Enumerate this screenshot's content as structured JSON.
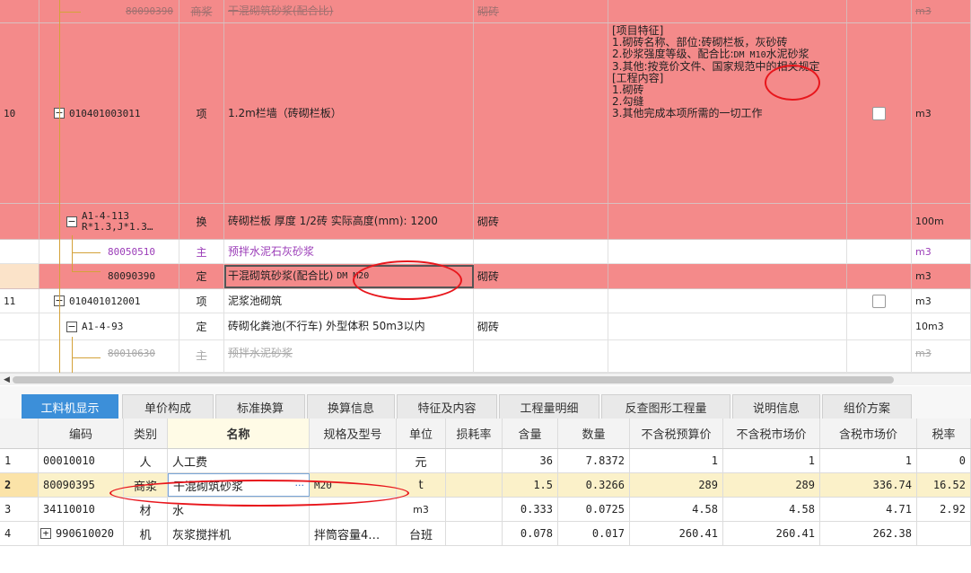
{
  "upper_rows": {
    "top_partial": {
      "code": "80090390",
      "type": "商浆",
      "name": "干混砌筑砂浆(配合比)",
      "spec": "砌砖",
      "unit": "m3"
    },
    "item10": {
      "index": "10",
      "code": "010401003011",
      "type": "项",
      "name": "1.2m栏墙（砖砌栏板）",
      "features": [
        "[项目特征]",
        "1.砌砖名称、部位:砖砌栏板，灰砂砖",
        "2.砂浆强度等级、配合比:",
        "DM M10",
        "水泥砂浆",
        "3.其他:按竞价文件、国家规范中的相关规定",
        "[工程内容]",
        "1.砌砖",
        "2.勾缝",
        "3.其他完成本项所需的一切工作"
      ],
      "unit": "m3"
    },
    "sub_a14113": {
      "code_line1": "A1-4-113",
      "code_line2": "R*1.3,J*1.3…",
      "type": "换",
      "name": "砖砌栏板 厚度 1/2砖  实际高度(mm): 1200",
      "spec": "砌砖",
      "unit": "100m"
    },
    "sub_80050510": {
      "code": "80050510",
      "type": "主",
      "name": "预拌水泥石灰砂浆",
      "unit": "m3"
    },
    "sub_80090390": {
      "code": "80090390",
      "type": "定",
      "name": "干混砌筑砂浆(配合比)",
      "name_extra": "DM M20",
      "spec": "砌砖",
      "unit": "m3"
    },
    "item11": {
      "index": "11",
      "code": "010401012001",
      "type": "项",
      "name": "泥浆池砌筑",
      "unit": "m3"
    },
    "sub_a1493": {
      "code": "A1-4-93",
      "type": "定",
      "name": "砖砌化粪池(不行车) 外型体积 50m3以内",
      "spec": "砌砖",
      "unit": "10m3"
    },
    "sub_80010630": {
      "code": "80010630",
      "type": "主",
      "name": "预拌水泥砂浆",
      "unit": "m3"
    }
  },
  "tabs": [
    "工料机显示",
    "单价构成",
    "标准换算",
    "换算信息",
    "特征及内容",
    "工程量明细",
    "反查图形工程量",
    "说明信息",
    "组价方案"
  ],
  "active_tab": "工料机显示",
  "grid": {
    "headers": [
      "编码",
      "类别",
      "名称",
      "规格及型号",
      "单位",
      "损耗率",
      "含量",
      "数量",
      "不含税预算价",
      "不含税市场价",
      "含税市场价",
      "税率"
    ],
    "rows": [
      {
        "idx": "1",
        "code": "00010010",
        "cat": "人",
        "name": "人工费",
        "spec": "",
        "unit": "元",
        "loss": "",
        "content": "36",
        "qty": "7.8372",
        "budget": "1",
        "market": "1",
        "taxmarket": "1",
        "tax": "0"
      },
      {
        "idx": "2",
        "code": "80090395",
        "cat": "商浆",
        "name": "干混砌筑砂浆",
        "spec": "M20",
        "unit": "t",
        "loss": "",
        "content": "1.5",
        "qty": "0.3266",
        "budget": "289",
        "market": "289",
        "taxmarket": "336.74",
        "tax": "16.52",
        "dots": "···"
      },
      {
        "idx": "3",
        "code": "34110010",
        "cat": "材",
        "name": "水",
        "spec": "",
        "unit": "m3",
        "loss": "",
        "content": "0.333",
        "qty": "0.0725",
        "budget": "4.58",
        "market": "4.58",
        "taxmarket": "4.71",
        "tax": "2.92"
      },
      {
        "idx": "4",
        "code": "990610020",
        "cat": "机",
        "name": "灰浆搅拌机",
        "spec": "拌筒容量4…",
        "unit": "台班",
        "loss": "",
        "content": "0.078",
        "qty": "0.017",
        "budget": "260.41",
        "market": "260.41",
        "taxmarket": "262.38",
        "tax": ""
      }
    ]
  },
  "colors": {
    "row_highlight": "#f48a8a",
    "active_tab": "#3c8fd9",
    "annotation": "#e8161c",
    "selected_row": "#fbf1c9"
  }
}
